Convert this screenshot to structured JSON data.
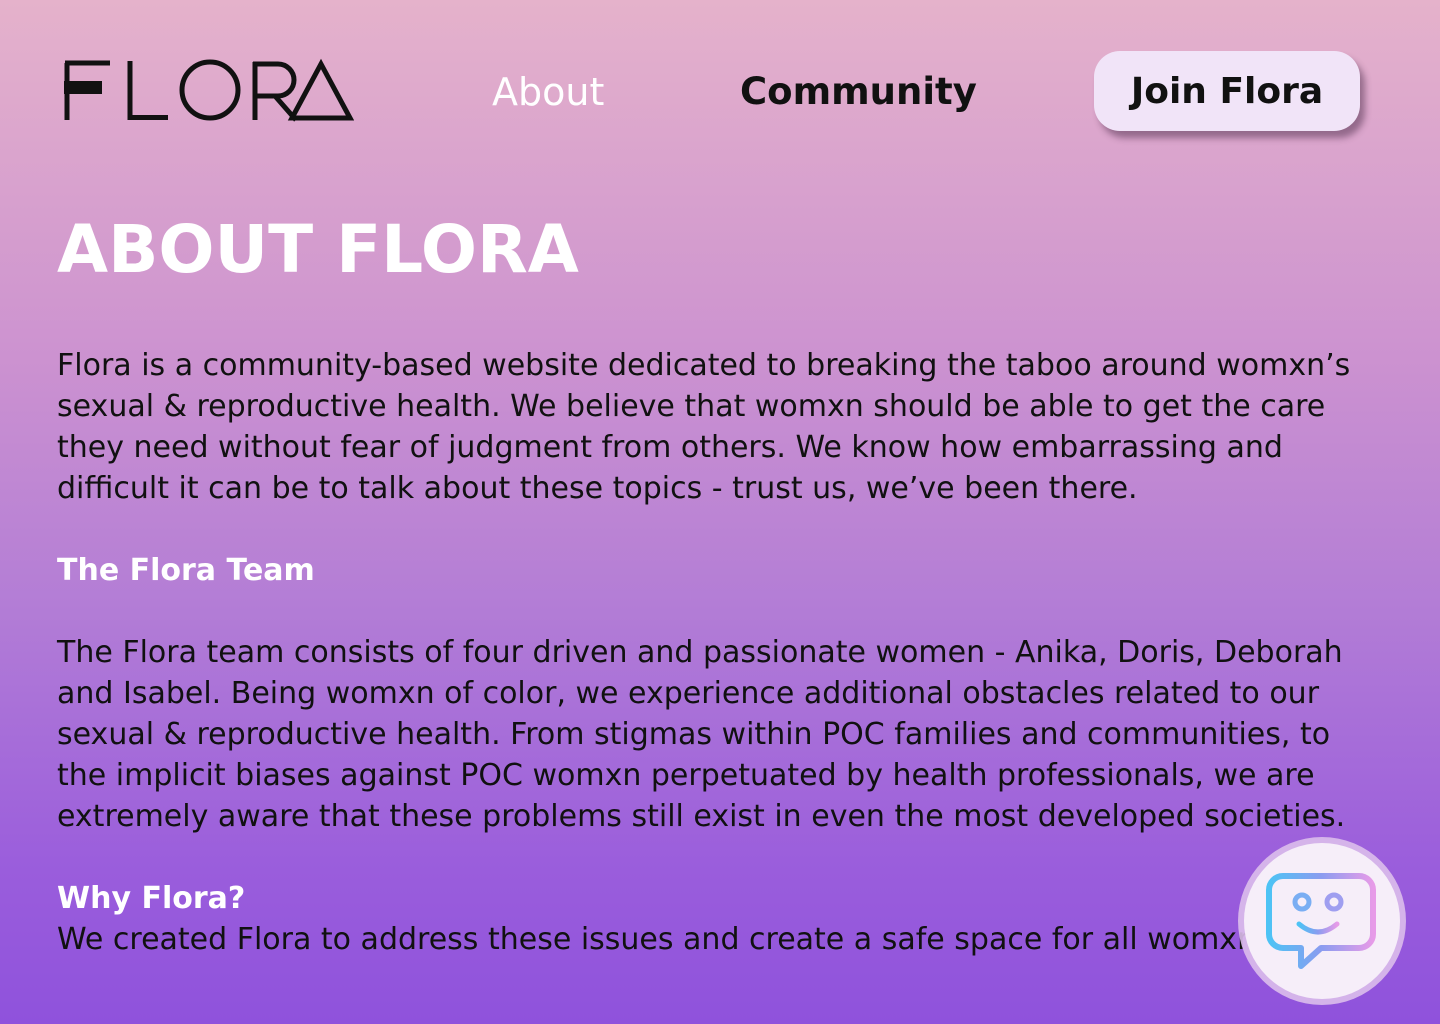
{
  "header": {
    "logo_text": "FLORA",
    "nav": {
      "about_label": "About",
      "community_label": "Community"
    },
    "join_label": "Join Flora"
  },
  "main": {
    "title": "ABOUT FLORA",
    "intro": "Flora is a community-based website dedicated to breaking the taboo around womxn’s sexual & reproductive health. We believe that womxn should be able to get the care they need without fear of judgment from others. We know how embarrassing and difficult it can be to talk about these topics - trust us, we’ve been there.",
    "team_heading": "The Flora Team",
    "team_text": "The Flora team consists of four driven and passionate women - Anika, Doris, Deborah and Isabel. Being womxn of color, we experience additional obstacles related to our sexual & reproductive health. From stigmas within POC families and communities, to the implicit biases against POC womxn perpetuated by health professionals, we are extremely aware that these problems still exist in even the most developed societies.",
    "why_heading": "Why Flora?",
    "why_text": "We created Flora to address these issues and create a safe space for all womxn"
  },
  "chat_widget": {
    "icon": "chat-bot-icon"
  },
  "colors": {
    "gradient_top": "#e5b2cb",
    "gradient_bottom": "#8f52dc",
    "button_bg": "#f1e4f8",
    "heading_white": "#ffffff"
  }
}
